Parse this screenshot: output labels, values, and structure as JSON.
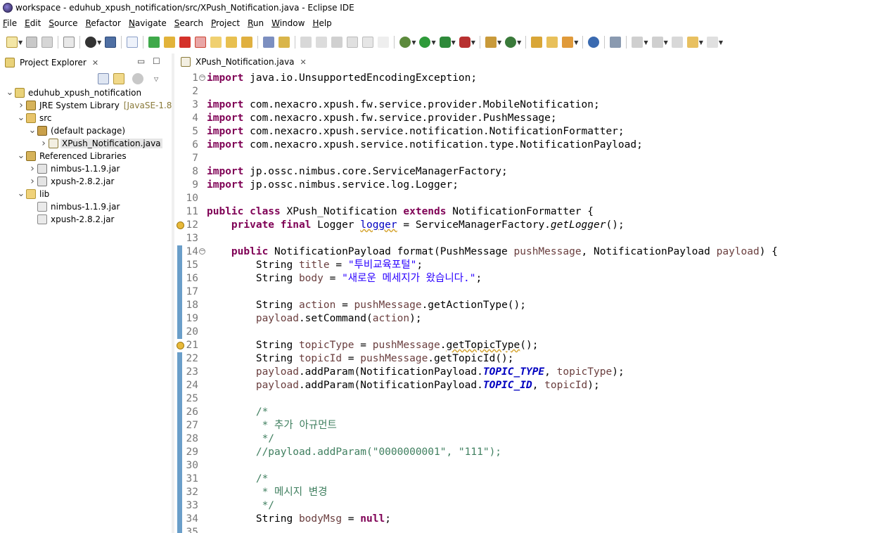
{
  "window": {
    "title": "workspace - eduhub_xpush_notification/src/XPush_Notification.java - Eclipse IDE"
  },
  "menu": [
    "File",
    "Edit",
    "Source",
    "Refactor",
    "Navigate",
    "Search",
    "Project",
    "Run",
    "Window",
    "Help"
  ],
  "explorer": {
    "tab_label": "Project Explorer",
    "tree": [
      {
        "label": "eduhub_xpush_notification",
        "depth": 0,
        "expanded": true,
        "icon": "project-icon"
      },
      {
        "label": "JRE System Library",
        "extra": "[JavaSE-1.8]",
        "depth": 1,
        "expanded": false,
        "icon": "library-icon"
      },
      {
        "label": "src",
        "depth": 1,
        "expanded": true,
        "icon": "source-folder-icon"
      },
      {
        "label": "(default package)",
        "depth": 2,
        "expanded": true,
        "icon": "package-icon"
      },
      {
        "label": "XPush_Notification.java",
        "depth": 3,
        "expanded": false,
        "icon": "java-file-icon",
        "selected": true
      },
      {
        "label": "Referenced Libraries",
        "depth": 1,
        "expanded": true,
        "icon": "library-icon"
      },
      {
        "label": "nimbus-1.1.9.jar",
        "depth": 2,
        "expanded": false,
        "icon": "jar-icon"
      },
      {
        "label": "xpush-2.8.2.jar",
        "depth": 2,
        "expanded": false,
        "icon": "jar-icon"
      },
      {
        "label": "lib",
        "depth": 1,
        "expanded": true,
        "icon": "folder-icon"
      },
      {
        "label": "nimbus-1.1.9.jar",
        "depth": 2,
        "icon": "jar-file-icon"
      },
      {
        "label": "xpush-2.8.2.jar",
        "depth": 2,
        "icon": "jar-file-icon"
      }
    ]
  },
  "editor": {
    "tab_label": "XPush_Notification.java",
    "lines": [
      {
        "n": "1",
        "fold": "minus",
        "html": "<span class=\"kw\">import</span> java.io.UnsupportedEncodingException;"
      },
      {
        "n": "2",
        "html": ""
      },
      {
        "n": "3",
        "html": "<span class=\"kw\">import</span> com.nexacro.xpush.fw.service.provider.MobileNotification;"
      },
      {
        "n": "4",
        "html": "<span class=\"kw\">import</span> com.nexacro.xpush.fw.service.provider.PushMessage;"
      },
      {
        "n": "5",
        "html": "<span class=\"kw\">import</span> com.nexacro.xpush.service.notification.NotificationFormatter;"
      },
      {
        "n": "6",
        "html": "<span class=\"kw\">import</span> com.nexacro.xpush.service.notification.type.NotificationPayload;"
      },
      {
        "n": "7",
        "html": ""
      },
      {
        "n": "8",
        "html": "<span class=\"kw\">import</span> jp.ossc.nimbus.core.ServiceManagerFactory;"
      },
      {
        "n": "9",
        "html": "<span class=\"kw\">import</span> jp.ossc.nimbus.service.log.Logger;"
      },
      {
        "n": "10",
        "html": ""
      },
      {
        "n": "11",
        "html": "<span class=\"kw\">public class</span> XPush_Notification <span class=\"kw\">extends</span> NotificationFormatter {"
      },
      {
        "n": "12",
        "ann": "warn",
        "html": "    <span class=\"kw\">private final</span> Logger <span class=\"fld wavy\">logger</span> = ServiceManagerFactory.<span class=\"ital\">getLogger</span>();"
      },
      {
        "n": "13",
        "html": ""
      },
      {
        "n": "14",
        "ann": "change",
        "fold": "minus",
        "html": "    <span class=\"kw\">public</span> NotificationPayload format(PushMessage <span class=\"var\">pushMessage</span>, NotificationPayload <span class=\"var\">payload</span>) {"
      },
      {
        "n": "15",
        "ann": "change",
        "html": "        String <span class=\"var\">title</span> = <span class=\"str\">\"투비교육포털\"</span>;"
      },
      {
        "n": "16",
        "ann": "change",
        "html": "        String <span class=\"var\">body</span> = <span class=\"str\">\"새로운 메세지가 왔습니다.\"</span>;"
      },
      {
        "n": "17",
        "ann": "change",
        "html": ""
      },
      {
        "n": "18",
        "ann": "change",
        "html": "        String <span class=\"var\">action</span> = <span class=\"var\">pushMessage</span>.getActionType();"
      },
      {
        "n": "19",
        "ann": "change",
        "html": "        <span class=\"var\">payload</span>.setCommand(<span class=\"var\">action</span>);"
      },
      {
        "n": "20",
        "ann": "change",
        "html": ""
      },
      {
        "n": "21",
        "ann": "warn",
        "html": "        String <span class=\"var\">topicType</span> = <span class=\"var\">pushMessage</span>.<span class=\"strike wavy\">getTopicType</span>();"
      },
      {
        "n": "22",
        "ann": "change",
        "html": "        String <span class=\"var\">topicId</span> = <span class=\"var\">pushMessage</span>.getTopicId();"
      },
      {
        "n": "23",
        "ann": "change",
        "html": "        <span class=\"var\">payload</span>.addParam(NotificationPayload.<span class=\"sfld\">TOPIC_TYPE</span>, <span class=\"var\">topicType</span>);"
      },
      {
        "n": "24",
        "ann": "change",
        "html": "        <span class=\"var\">payload</span>.addParam(NotificationPayload.<span class=\"sfld\">TOPIC_ID</span>, <span class=\"var\">topicId</span>);"
      },
      {
        "n": "25",
        "ann": "change",
        "html": ""
      },
      {
        "n": "26",
        "ann": "change",
        "html": "        <span class=\"cm\">/*</span>"
      },
      {
        "n": "27",
        "ann": "change",
        "html": "        <span class=\"cm\"> * 추가 아규먼트</span>"
      },
      {
        "n": "28",
        "ann": "change",
        "html": "        <span class=\"cm\"> */</span>"
      },
      {
        "n": "29",
        "ann": "change",
        "html": "        <span class=\"cm\">//payload.addParam(\"0000000001\", \"111\");</span>"
      },
      {
        "n": "30",
        "ann": "change",
        "html": ""
      },
      {
        "n": "31",
        "ann": "change",
        "html": "        <span class=\"cm\">/*</span>"
      },
      {
        "n": "32",
        "ann": "change",
        "html": "        <span class=\"cm\"> * 메시지 변경</span>"
      },
      {
        "n": "33",
        "ann": "change",
        "html": "        <span class=\"cm\"> */</span>"
      },
      {
        "n": "34",
        "ann": "change",
        "html": "        String <span class=\"var\">bodyMsg</span> = <span class=\"kw\">null</span>;"
      },
      {
        "n": "35",
        "ann": "change",
        "html": ""
      }
    ]
  },
  "colors": {
    "keyword": "#7f0055",
    "string": "#2a00ff",
    "comment": "#3f7f5f",
    "field": "#0000c0",
    "annotation_bar": "#6a9ec9"
  }
}
